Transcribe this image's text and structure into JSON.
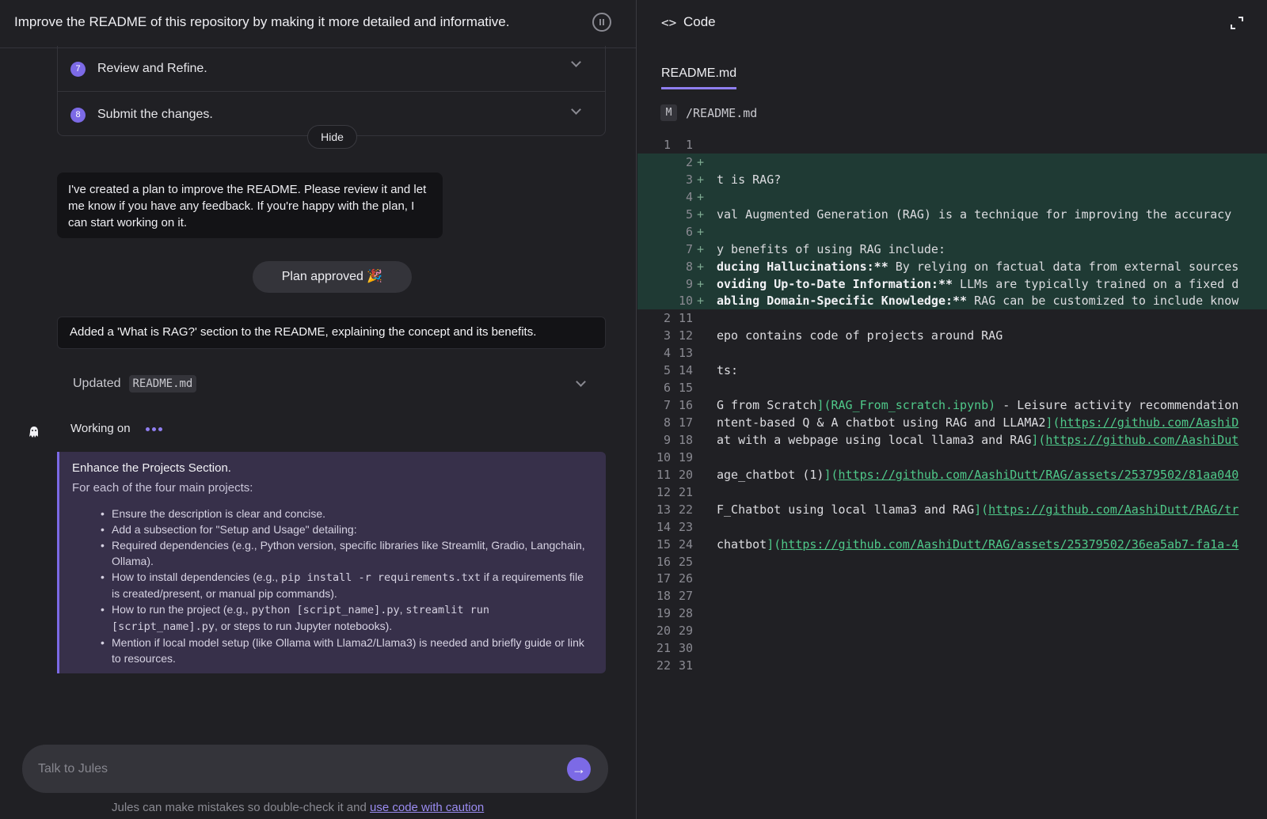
{
  "header": {
    "title": "Improve the README of this repository by making it more detailed and informative."
  },
  "steps": [
    {
      "num": "7",
      "label": "Review and Refine."
    },
    {
      "num": "8",
      "label": "Submit the changes."
    }
  ],
  "hide_label": "Hide",
  "plan_message": "I've created a plan to improve the README. Please review it and let me know if you have any feedback. If you're happy with the plan, I can start working on it.",
  "approved_label": "Plan approved 🎉",
  "added_message": "Added a 'What is RAG?' section to the README, explaining the concept and its benefits.",
  "updated": {
    "label": "Updated",
    "file": "README.md"
  },
  "working": {
    "label": "Working on"
  },
  "task": {
    "title": "Enhance the Projects Section.",
    "subtitle": "For each of the four main projects:",
    "items": [
      "Ensure the description is clear and concise.",
      "Add a subsection for \"Setup and Usage\" detailing:",
      "Required dependencies (e.g., Python version, specific libraries like Streamlit, Gradio, Langchain, Ollama).",
      "How to install dependencies (e.g., pip install -r requirements.txt if a requirements file is created/present, or manual pip commands).",
      "How to run the project (e.g., python [script_name].py, streamlit run [script_name].py, or steps to run Jupyter notebooks).",
      "Mention if local model setup (like Ollama with Llama2/Llama3) is needed and briefly guide or link to resources."
    ]
  },
  "input": {
    "placeholder": "Talk to Jules"
  },
  "disclaimer": {
    "text": "Jules can make mistakes so double-check it and ",
    "link": "use code with caution"
  },
  "code_panel": {
    "label": "Code",
    "tab": "README.md",
    "status_badge": "M",
    "file_path": "/README.md"
  },
  "diff_lines": [
    {
      "old": "1",
      "new": "1",
      "add": false,
      "text": ""
    },
    {
      "old": "",
      "new": "2",
      "add": true,
      "text": ""
    },
    {
      "old": "",
      "new": "3",
      "add": true,
      "text": "t is RAG?"
    },
    {
      "old": "",
      "new": "4",
      "add": true,
      "text": ""
    },
    {
      "old": "",
      "new": "5",
      "add": true,
      "text": "val Augmented Generation (RAG) is a technique for improving the accuracy"
    },
    {
      "old": "",
      "new": "6",
      "add": true,
      "text": ""
    },
    {
      "old": "",
      "new": "7",
      "add": true,
      "text": "y benefits of using RAG include:"
    },
    {
      "old": "",
      "new": "8",
      "add": true,
      "bold": "ducing Hallucinations:**",
      "text": " By relying on factual data from external sources"
    },
    {
      "old": "",
      "new": "9",
      "add": true,
      "bold": "oviding Up-to-Date Information:**",
      "text": " LLMs are typically trained on a fixed d"
    },
    {
      "old": "",
      "new": "10",
      "add": true,
      "bold": "abling Domain-Specific Knowledge:**",
      "text": " RAG can be customized to include know"
    },
    {
      "old": "2",
      "new": "11",
      "add": false,
      "text": ""
    },
    {
      "old": "3",
      "new": "12",
      "add": false,
      "text": "epo contains code of projects around RAG"
    },
    {
      "old": "4",
      "new": "13",
      "add": false,
      "text": ""
    },
    {
      "old": "5",
      "new": "14",
      "add": false,
      "text": "ts:"
    },
    {
      "old": "6",
      "new": "15",
      "add": false,
      "text": ""
    },
    {
      "old": "7",
      "new": "16",
      "add": false,
      "text": "G from Scratch",
      "green": "](RAG_From_scratch.ipynb)",
      "tail": " - Leisure activity recommendation"
    },
    {
      "old": "8",
      "new": "17",
      "add": false,
      "text": "ntent-based Q & A chatbot using RAG and LLAMA2",
      "green": "](",
      "link": "https://github.com/AashiD"
    },
    {
      "old": "9",
      "new": "18",
      "add": false,
      "text": "at with a webpage using local llama3 and RAG",
      "green": "](",
      "link": "https://github.com/AashiDut"
    },
    {
      "old": "10",
      "new": "19",
      "add": false,
      "text": ""
    },
    {
      "old": "11",
      "new": "20",
      "add": false,
      "text": "age_chatbot (1)",
      "green": "](",
      "link": "https://github.com/AashiDutt/RAG/assets/25379502/81aa040"
    },
    {
      "old": "12",
      "new": "21",
      "add": false,
      "text": ""
    },
    {
      "old": "13",
      "new": "22",
      "add": false,
      "text": "F_Chatbot using local llama3 and RAG",
      "green": "](",
      "link": "https://github.com/AashiDutt/RAG/tr"
    },
    {
      "old": "14",
      "new": "23",
      "add": false,
      "text": ""
    },
    {
      "old": "15",
      "new": "24",
      "add": false,
      "text": "chatbot",
      "green": "](",
      "link": "https://github.com/AashiDutt/RAG/assets/25379502/36ea5ab7-fa1a-4"
    },
    {
      "old": "16",
      "new": "25",
      "add": false,
      "text": ""
    },
    {
      "old": "17",
      "new": "26",
      "add": false,
      "text": ""
    },
    {
      "old": "18",
      "new": "27",
      "add": false,
      "text": ""
    },
    {
      "old": "19",
      "new": "28",
      "add": false,
      "text": ""
    },
    {
      "old": "20",
      "new": "29",
      "add": false,
      "text": ""
    },
    {
      "old": "21",
      "new": "30",
      "add": false,
      "text": ""
    },
    {
      "old": "22",
      "new": "31",
      "add": false,
      "text": ""
    }
  ],
  "colors": {
    "accent": "#7c6ae6",
    "diff_add_bg": "#1f3a34",
    "link": "#4fc98a"
  }
}
